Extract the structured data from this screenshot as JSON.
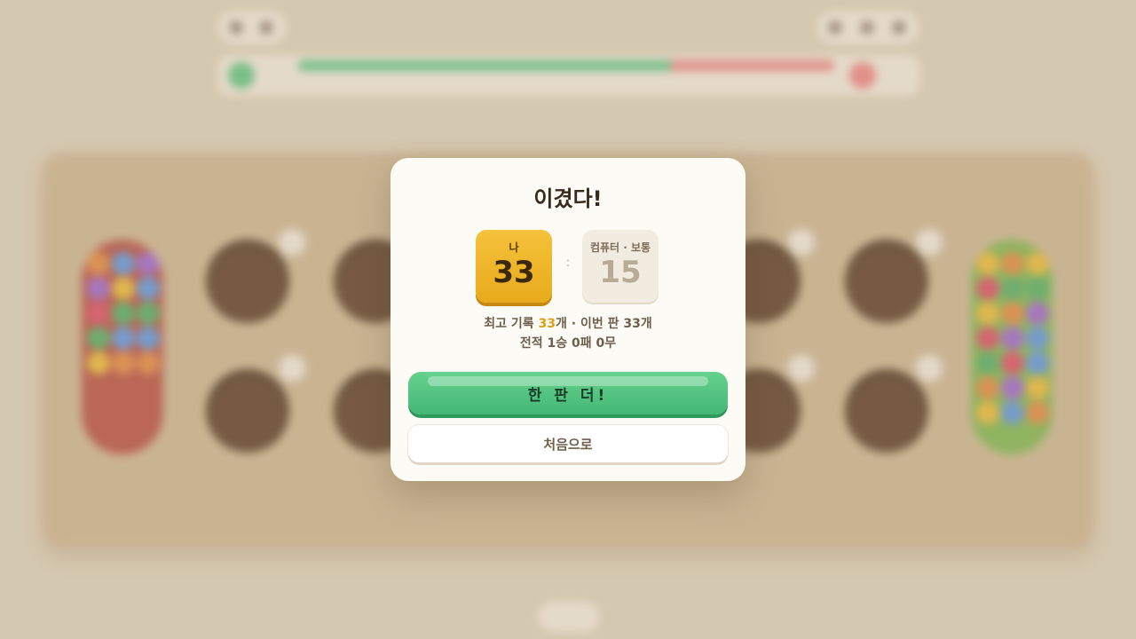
{
  "colors": {
    "accent_green": "#4cbe7d",
    "accent_gold": "#f0b62e",
    "player_color": "#5cbf7f",
    "cpu_color": "#e98080",
    "board": "#c9b08c",
    "pit": "#5a3a22",
    "store_left": "#b44a3e",
    "store_right": "#7bb04a"
  },
  "background_state": {
    "player_share": 0.7,
    "cpu_share": 0.3
  },
  "result_modal": {
    "title": "이겼다!",
    "me": {
      "label": "나",
      "score": "33"
    },
    "separator": ":",
    "cpu": {
      "label": "컴퓨터 · 보통",
      "score": "15"
    },
    "best_record": {
      "prefix": "최고 기록 ",
      "value": "33",
      "suffix": "개 · 이번 판 33개"
    },
    "match_record": "전적 1승 0패 0무",
    "play_again_label": "한 판 더!",
    "home_label": "처음으로"
  },
  "icons": {
    "background": [
      "back-icon",
      "home-icon",
      "sound-icon",
      "help-icon",
      "settings-icon",
      "player-avatar-icon",
      "cpu-avatar-icon"
    ]
  }
}
